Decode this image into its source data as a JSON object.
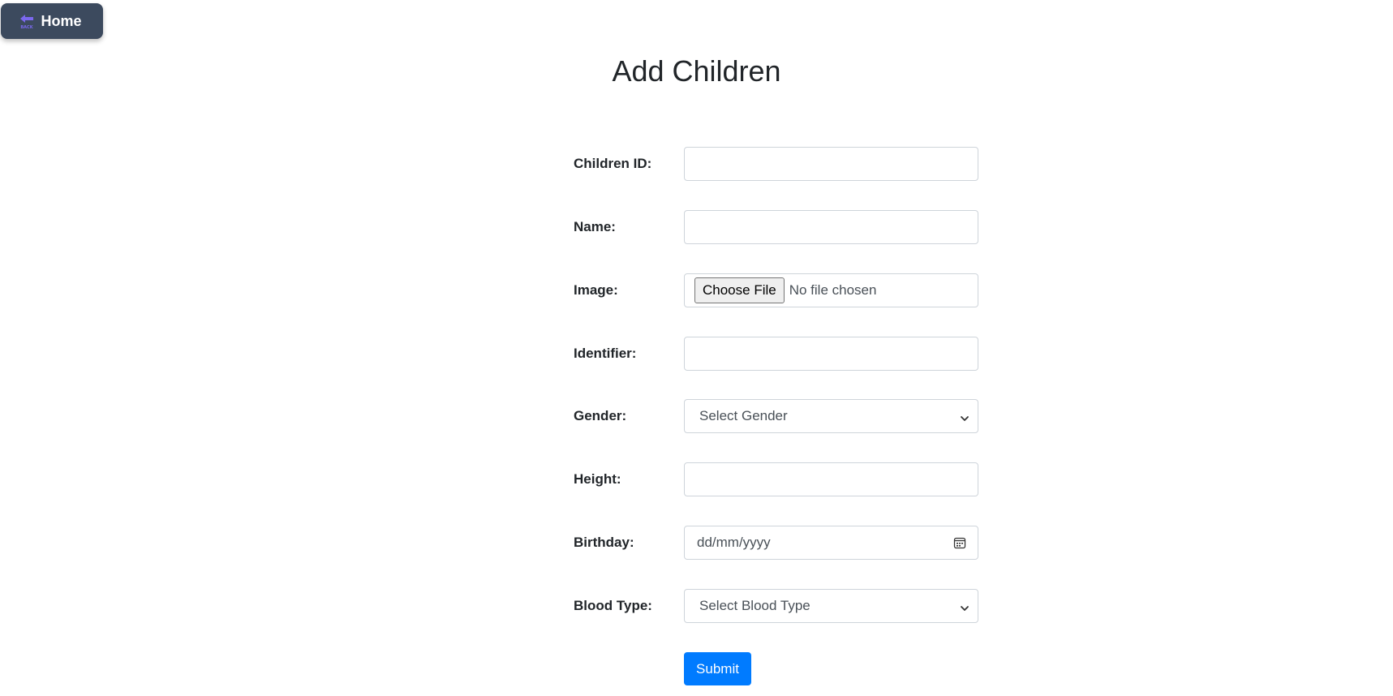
{
  "nav": {
    "home_label": "Home",
    "back_icon_text": "BACK"
  },
  "page": {
    "title": "Add Children"
  },
  "form": {
    "children_id": {
      "label": "Children ID:",
      "value": ""
    },
    "name": {
      "label": "Name:",
      "value": ""
    },
    "image": {
      "label": "Image:",
      "button_label": "Choose File",
      "status": "No file chosen"
    },
    "identifier": {
      "label": "Identifier:",
      "value": ""
    },
    "gender": {
      "label": "Gender:",
      "selected": "Select Gender"
    },
    "height": {
      "label": "Height:",
      "value": ""
    },
    "birthday": {
      "label": "Birthday:",
      "placeholder": "dd/mm/yyyy"
    },
    "blood_type": {
      "label": "Blood Type:",
      "selected": "Select Blood Type"
    },
    "submit_label": "Submit"
  },
  "colors": {
    "home_button_bg": "#3c4a5e",
    "back_icon": "#7b68ee",
    "submit_bg": "#007bff",
    "input_border": "#ced4da"
  }
}
